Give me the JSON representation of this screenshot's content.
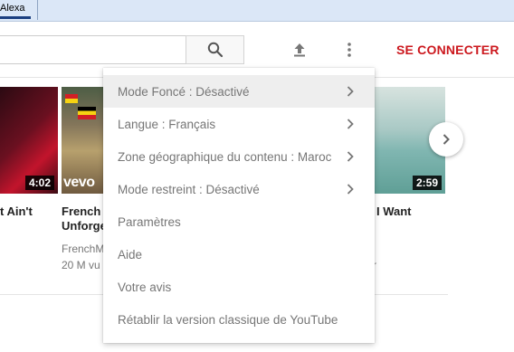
{
  "browser": {
    "bookmark_label": "Alexa"
  },
  "header": {
    "search_placeholder": "",
    "search_icon": "magnifier-icon",
    "upload_icon": "upload-icon",
    "more_icon": "vertical-dots-icon",
    "signin_label": "SE CONNECTER"
  },
  "videos": [
    {
      "title": "t Ain't",
      "duration": "4:02"
    },
    {
      "title_line1": "French",
      "title_line2": "Unforge",
      "channel": "FrenchM",
      "views": "20 M vu",
      "badge": "vevo"
    },
    {
      "title": "I Want",
      "duration": "2:59",
      "meta_fragment": "r"
    }
  ],
  "menu": {
    "items": [
      {
        "label": "Mode Foncé : Désactivé",
        "has_submenu": true,
        "highlighted": true
      },
      {
        "label": "Langue : Français",
        "has_submenu": true
      },
      {
        "label": "Zone géographique du contenu : Maroc",
        "has_submenu": true
      },
      {
        "label": "Mode restreint : Désactivé",
        "has_submenu": true
      },
      {
        "label": "Paramètres",
        "has_submenu": false
      },
      {
        "label": "Aide",
        "has_submenu": false
      },
      {
        "label": "Votre avis",
        "has_submenu": false
      },
      {
        "label": "Rétablir la version classique de YouTube",
        "has_submenu": false
      }
    ]
  },
  "colors": {
    "brand_red": "#cc181e",
    "menu_text": "#767676",
    "menu_highlight": "#eeeeee"
  }
}
